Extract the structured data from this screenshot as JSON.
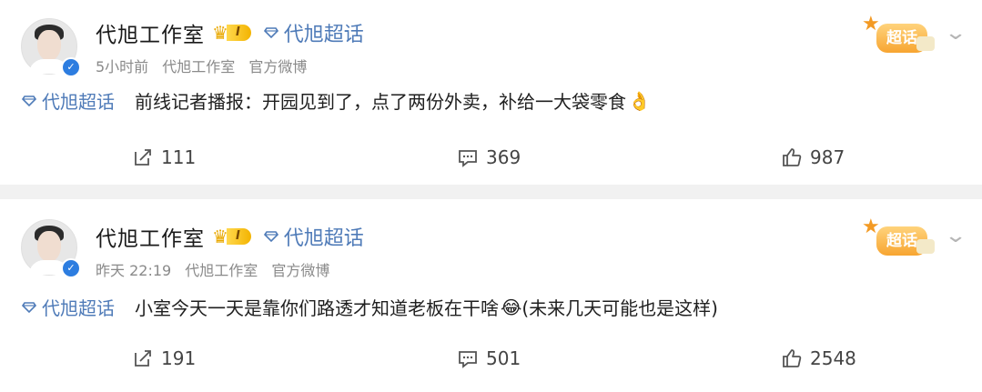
{
  "posts": [
    {
      "author": "代旭工作室",
      "vip_level": "I",
      "topic_link": "代旭超话",
      "time": "5小时前",
      "source": "代旭工作室",
      "source_type": "官方微博",
      "sticker_label": "超话",
      "content_tag": "代旭超话",
      "content_text": "前线记者播报：开园见到了，点了两份外卖，补给一大袋零食",
      "content_emoji": "👌",
      "reposts": "111",
      "comments": "369",
      "likes": "987"
    },
    {
      "author": "代旭工作室",
      "vip_level": "I",
      "topic_link": "代旭超话",
      "time": "昨天 22:19",
      "source": "代旭工作室",
      "source_type": "官方微博",
      "sticker_label": "超话",
      "content_tag": "代旭超话",
      "content_text": "小室今天一天是靠你们路透才知道老板在干啥",
      "content_emoji": "😂",
      "content_suffix": "(未来几天可能也是这样)",
      "reposts": "191",
      "comments": "501",
      "likes": "2548"
    }
  ],
  "icons": {
    "verified": "verified-badge-icon",
    "crown": "crown-icon",
    "diamond": "diamond-icon",
    "repost": "repost-icon",
    "comment": "comment-icon",
    "like": "like-icon",
    "more": "chevron-down-icon"
  },
  "colors": {
    "link": "#4f7bb8",
    "meta": "#8a8a8a",
    "verified": "#2d7de0",
    "vip": "#f3b300",
    "separator": "#f1f1f1"
  }
}
